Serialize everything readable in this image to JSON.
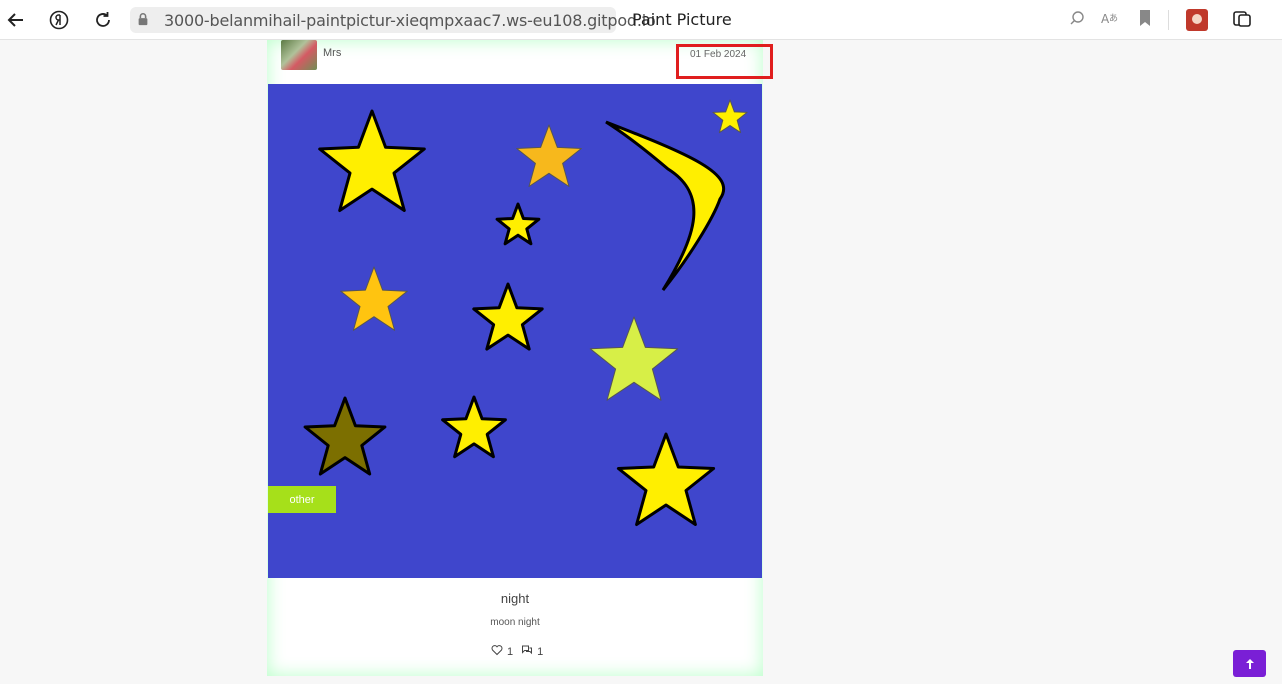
{
  "browser": {
    "url": "3000-belanmihail-paintpictur-xieqmpxaac7.ws-eu108.gitpod.io",
    "page_title": "Paint Picture",
    "icons": [
      "back-arrow-icon",
      "yandex-icon",
      "reload-icon",
      "lock-icon",
      "search-icon",
      "translate-icon",
      "bookmark-icon",
      "extension-avatar-icon",
      "tabs-icon"
    ]
  },
  "post": {
    "author": "Mrs",
    "date": "01 Feb 2024",
    "category": "other",
    "title": "night",
    "description": "moon night",
    "likes": "1",
    "comments": "1"
  },
  "colors": {
    "canvas_bg": "#3f46cc",
    "tag_bg": "#a6e01a",
    "highlight": "#e01e1e",
    "to_top_bg": "#7a1fd6"
  }
}
